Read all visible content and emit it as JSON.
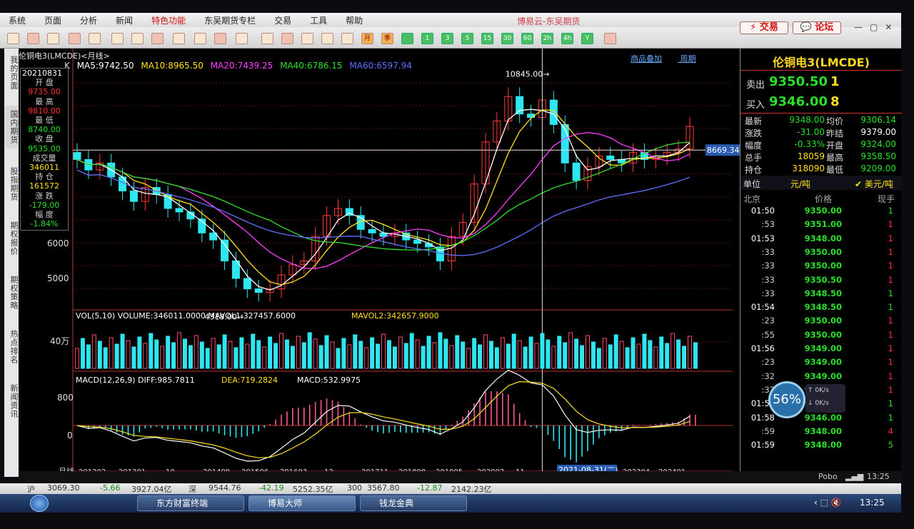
{
  "menu": {
    "items": [
      "系统",
      "页面",
      "分析",
      "新闻",
      "特色功能",
      "东吴期货专栏",
      "交易",
      "工具",
      "帮助"
    ],
    "center_title": "博易云-东吴期货",
    "trade_button": "交易",
    "forum_button": "论坛"
  },
  "toolbar": {
    "period_buttons": [
      "月",
      "季",
      "1",
      "3",
      "5",
      "15",
      "30",
      "60",
      "2h",
      "4h",
      "Y"
    ]
  },
  "left_tabs": [
    "我的页面",
    "国内期货",
    "股指期货",
    "期权报价",
    "期权策略",
    "热点排名",
    "新闻资讯"
  ],
  "chart": {
    "title": "伦铜电3(LMCDE)<月线>",
    "k_label": "K",
    "ma_legend": [
      {
        "text": "MA5:9742.50",
        "color": "#ffffff"
      },
      {
        "text": "MA10:8965.50",
        "color": "#ffe020"
      },
      {
        "text": "MA20:7439.25",
        "color": "#ff40ff"
      },
      {
        "text": "MA40:6786.15",
        "color": "#30e030"
      },
      {
        "text": "MA60:6597.94",
        "color": "#6070ff"
      }
    ],
    "links": [
      "商品叠加",
      "周期"
    ],
    "info": {
      "date": "20210831",
      "open_label": "开 盘",
      "open": "9735.00",
      "high_label": "最 高",
      "high": "9810.00",
      "low_label": "最 低",
      "low": "8740.00",
      "close_label": "收 盘",
      "close": "9535.00",
      "volume_label": "成交量",
      "volume": "346011",
      "oi_label": "持 仓",
      "oi": "161572",
      "chg_label": "涨 跌",
      "chg": "-179.00",
      "pct_label": "幅 度",
      "pct": "-1.84%"
    },
    "y_ticks": [
      "6000",
      "5000"
    ],
    "high_marker": "10845.00",
    "low_marker": "4318.00",
    "crosshair_value": "8669.34",
    "crosshair_date": "2021-08-31(二)",
    "vol_legend": {
      "title": "VOL(5,10)",
      "volume": "VOLUME:346011.0000",
      "mavol1": "MAVOL1:327457.6000",
      "mavol2": "MAVOL2:342657.9000"
    },
    "vol_tick": "40万",
    "macd_legend": {
      "title": "MACD(12,26,9)",
      "diff": "DIFF:985.7811",
      "dea": "DEA:719.2824",
      "macd": "MACD:532.9975"
    },
    "macd_ticks": [
      "800",
      "0"
    ],
    "x_label_head": "月线",
    "x_labels": [
      "201202",
      "201301",
      "10",
      "201409",
      "201506",
      "201603",
      "12",
      "201711",
      "201808",
      "201905",
      "202002",
      "11",
      "2021-08-31(二)",
      "202304",
      "202401"
    ]
  },
  "chart_data": {
    "type": "candlestick",
    "period": "月线",
    "ohlc_2021_08": {
      "open": 9735.0,
      "high": 9810.0,
      "low": 8740.0,
      "close": 9535.0,
      "volume": 346011,
      "open_interest": 161572,
      "change": -179.0,
      "change_pct": "-1.84%"
    },
    "ma": {
      "MA5": 9742.5,
      "MA10": 8965.5,
      "MA20": 7439.25,
      "MA40": 6786.15,
      "MA60": 6597.94
    },
    "extremes": {
      "high": 10845.0,
      "low": 4318.0
    },
    "macd": {
      "DIFF": 985.7811,
      "DEA": 719.2824,
      "MACD": 532.9975
    },
    "vol": {
      "VOLUME": 346011.0,
      "MAVOL1": 327457.6,
      "MAVOL2": 342657.9
    },
    "y_ticks": [
      5000,
      6000
    ],
    "approx_close_series": [
      8400,
      8100,
      8300,
      7900,
      7500,
      7200,
      7600,
      7400,
      7000,
      6900,
      6700,
      6300,
      6100,
      5500,
      5000,
      4700,
      4600,
      4700,
      5100,
      5400,
      5500,
      6200,
      6800,
      7000,
      6800,
      6400,
      6300,
      6200,
      6300,
      6100,
      6000,
      5900,
      5500,
      6200,
      6600,
      7700,
      8900,
      9500,
      10200,
      9700,
      9600,
      10100,
      9400,
      8300,
      7800,
      8200,
      8500,
      8400,
      8300,
      8600,
      8400,
      8500,
      8600,
      8700,
      9346
    ]
  },
  "quote": {
    "title": "伦铜电3(LMCDE)",
    "sell_label": "卖出",
    "sell_price": "9350.50",
    "sell_vol": "1",
    "buy_label": "买入",
    "buy_price": "9346.00",
    "buy_vol": "8",
    "rows": [
      {
        "k1": "最新",
        "v1": "9348.00",
        "c1": "#29e029",
        "k2": "均价",
        "v2": "9306.14",
        "c2": "#29e029"
      },
      {
        "k1": "涨跌",
        "v1": "-31.00",
        "c1": "#29e029",
        "k2": "昨结",
        "v2": "9379.00",
        "c2": "#ffffff"
      },
      {
        "k1": "幅度",
        "v1": "-0.33%",
        "c1": "#29e029",
        "k2": "开盘",
        "v2": "9324.00",
        "c2": "#29e029"
      },
      {
        "k1": "总手",
        "v1": "18059",
        "c1": "#ffe020",
        "k2": "最高",
        "v2": "9358.50",
        "c2": "#29e029"
      },
      {
        "k1": "持仓",
        "v1": "318090",
        "c1": "#ffe020",
        "k2": "最低",
        "v2": "9209.00",
        "c2": "#29e029"
      }
    ],
    "unit_label": "单位",
    "unit_cny": "元/吨",
    "unit_usd": "美元/吨",
    "col_time": "北京",
    "col_price": "价格",
    "col_vol": "现手"
  },
  "trades": [
    {
      "t": "01:50",
      "p": "9350.00",
      "v": "1",
      "c": "#29e029"
    },
    {
      "t": ":53",
      "p": "9351.00",
      "v": "1",
      "c": "#ff3030"
    },
    {
      "t": "01:53",
      "p": "9348.00",
      "v": "1",
      "c": "#ff3030"
    },
    {
      "t": ":33",
      "p": "9350.00",
      "v": "1",
      "c": "#ff3030"
    },
    {
      "t": ":33",
      "p": "9350.00",
      "v": "1",
      "c": "#ff3030"
    },
    {
      "t": ":33",
      "p": "9350.50",
      "v": "1",
      "c": "#ff3030"
    },
    {
      "t": ":33",
      "p": "9348.50",
      "v": "1",
      "c": "#29e029"
    },
    {
      "t": "01:54",
      "p": "9348.50",
      "v": "1",
      "c": "#29e029"
    },
    {
      "t": ":23",
      "p": "9350.00",
      "v": "1",
      "c": "#ff3030"
    },
    {
      "t": ":55",
      "p": "9350.00",
      "v": "1",
      "c": "#ff3030"
    },
    {
      "t": "01:56",
      "p": "9349.00",
      "v": "1",
      "c": "#ff3030"
    },
    {
      "t": ":23",
      "p": "9349.00",
      "v": "1",
      "c": "#ff3030"
    },
    {
      "t": ":32",
      "p": "9349.00",
      "v": "1",
      "c": "#ff3030"
    },
    {
      "t": ":32",
      "p": "9348.00",
      "v": "1",
      "c": "#ff3030"
    },
    {
      "t": "01:57",
      "p": "9348.00",
      "v": "1",
      "c": "#29e029"
    },
    {
      "t": "01:58",
      "p": "9346.00",
      "v": "1",
      "c": "#29e029"
    },
    {
      "t": ":59",
      "p": "9348.00",
      "v": "4",
      "c": "#ff3030"
    },
    {
      "t": "01:59",
      "p": "9348.00",
      "v": "5",
      "c": "#29e029"
    }
  ],
  "net_widget": {
    "percent": "56%",
    "up": "0K/s",
    "down": "0K/s"
  },
  "status": {
    "brand": "Pobo",
    "time": "13:25"
  },
  "bottom_quotes": {
    "sh_label": "沪",
    "sh_value": "3069.30",
    "sh_chg": "-5.66",
    "sh_amt": "3927.04亿",
    "sz_label": "深",
    "sz_value": "9544.76",
    "sz_chg": "-42.19",
    "sz_amt": "5252.35亿",
    "c_label": "300",
    "c_value": "3567.80",
    "c_chg": "-12.87",
    "c_amt": "2142.23亿"
  },
  "taskbar": {
    "tasks": [
      "东方财富终端",
      "博易大师",
      "钱龙金典"
    ],
    "clock": "13:25"
  }
}
